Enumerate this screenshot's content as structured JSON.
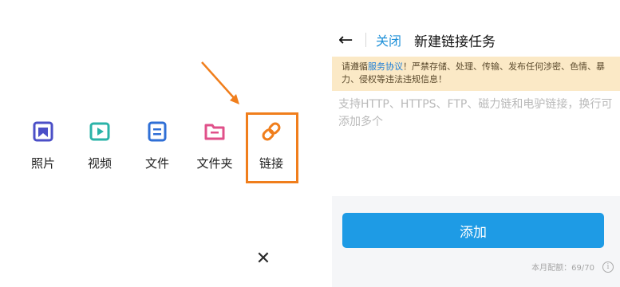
{
  "upload_menu": {
    "items": [
      {
        "label": "照片",
        "icon": "photo-icon"
      },
      {
        "label": "视频",
        "icon": "video-icon"
      },
      {
        "label": "文件",
        "icon": "file-icon"
      },
      {
        "label": "文件夹",
        "icon": "folder-icon"
      },
      {
        "label": "链接",
        "icon": "link-icon"
      }
    ],
    "close_glyph": "✕"
  },
  "task_page": {
    "back_glyph": "←",
    "close_label": "关闭",
    "title": "新建链接任务",
    "notice_prefix": "请遵循",
    "notice_link": "服务协议",
    "notice_suffix": "！严禁存储、处理、传输、发布任何涉密、色情、暴力、侵权等违法违规信息！",
    "input_placeholder": "支持HTTP、HTTPS、FTP、磁力链和电驴链接，换行可添加多个",
    "add_label": "添加",
    "quota_text": "本月配额：69/70",
    "info_glyph": "i"
  },
  "colors": {
    "accent": "#1e9be5",
    "highlight": "#f07e1c",
    "notice_bg": "#fbe9c6",
    "photo": "#4b4fc7",
    "video": "#2bb3a8",
    "file": "#2f6fd6",
    "folder": "#e0508a",
    "link": "#f07e1c"
  }
}
